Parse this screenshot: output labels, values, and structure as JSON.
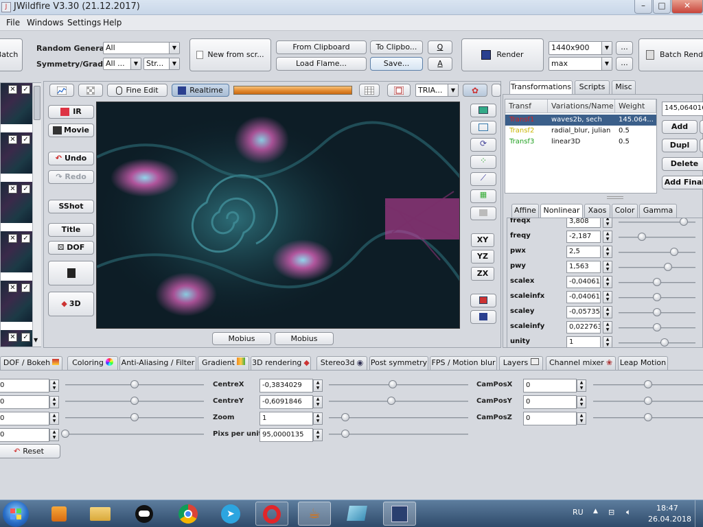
{
  "window": {
    "title": "JWildfire V3.30 (21.12.2017)",
    "minimize": "–",
    "maximize": "□",
    "close": "✕"
  },
  "menu": [
    "File",
    "Windows",
    "Settings",
    "Help"
  ],
  "toolbar": {
    "batch_left": "Batch",
    "random_generator_label": "Random Generator",
    "random_generator_value": "All",
    "symmetry_label": "Symmetry/Gradient",
    "symmetry_value": "All ...",
    "gradient_value": "Str...",
    "new_from_script": "New from scr...",
    "from_clipboard": "From Clipboard",
    "to_clipboard": "To Clipbo...",
    "q": "Q",
    "load_flame": "Load Flame...",
    "save": "Save...",
    "a": "A",
    "render": "Render",
    "resolution": "1440x900",
    "quality": "max",
    "more1": "...",
    "more2": "...",
    "batch_render": "Batch Render"
  },
  "preview_toolbar": {
    "fine_edit": "Fine Edit",
    "realtime": "Realtime",
    "triangle_mode": "TRIA..."
  },
  "left_buttons": {
    "ir": "IR",
    "movie": "Movie",
    "undo": "Undo",
    "redo": "Redo",
    "sshot": "SShot",
    "title": "Title",
    "dof": "DOF",
    "three_d": "3D"
  },
  "right_side_buttons": {
    "xy": "XY",
    "yz": "YZ",
    "zx": "ZX"
  },
  "mobius": [
    "Mobius",
    "Mobius"
  ],
  "right_tabs": [
    "Transformations",
    "Scripts",
    "Misc"
  ],
  "transforms_table": {
    "headers": [
      "Transf",
      "Variations/Name",
      "Weight"
    ],
    "rows": [
      {
        "name": "Transf1",
        "variations": "waves2b, sech",
        "weight": "145.064...",
        "color": "#d42020",
        "selected": true
      },
      {
        "name": "Transf2",
        "variations": "radial_blur, julian",
        "weight": "0.5",
        "color": "#c8b400",
        "selected": false
      },
      {
        "name": "Transf3",
        "variations": "linear3D",
        "weight": "0.5",
        "color": "#20a020",
        "selected": false
      }
    ]
  },
  "transform_side": {
    "weight_value": "145,064016",
    "add": "Add",
    "dupl": "Dupl",
    "delete": "Delete",
    "add_final": "Add Final"
  },
  "subtabs": [
    "Affine",
    "Nonlinear",
    "Xaos",
    "Color",
    "Gamma"
  ],
  "nonlinear_params": [
    {
      "label": "freqx",
      "value": "3,808",
      "level": 0.85
    },
    {
      "label": "freqy",
      "value": "-2,187",
      "level": 0.3
    },
    {
      "label": "pwx",
      "value": "2,5",
      "level": 0.72
    },
    {
      "label": "pwy",
      "value": "1,563",
      "level": 0.64
    },
    {
      "label": "scalex",
      "value": "-0,04061",
      "level": 0.5
    },
    {
      "label": "scaleinfx",
      "value": "-0,04061",
      "level": 0.5
    },
    {
      "label": "scaley",
      "value": "-0,05735",
      "level": 0.5
    },
    {
      "label": "scaleinfy",
      "value": "0,022763",
      "level": 0.5
    },
    {
      "label": "unity",
      "value": "1",
      "level": 0.6
    }
  ],
  "bottom_tabs": [
    "DOF / Bokeh",
    "Coloring",
    "Anti-Aliasing / Filter",
    "Gradient",
    "3D rendering",
    "Stereo3d",
    "Post symmetry",
    "FPS / Motion blur",
    "Layers",
    "Channel mixer",
    "Leap Motion"
  ],
  "camera": {
    "left_fields": [
      {
        "value": "0",
        "level": 0.5
      },
      {
        "value": "0",
        "level": 0.5
      },
      {
        "value": "0",
        "level": 0.5
      },
      {
        "value": "0",
        "level": 0.0
      }
    ],
    "reset": "Reset",
    "mid_fields": [
      {
        "label": "CentreX",
        "value": "-0,3834029",
        "level": 0.46
      },
      {
        "label": "CentreY",
        "value": "-0,6091846",
        "level": 0.45
      },
      {
        "label": "Zoom",
        "value": "1",
        "level": 0.12
      },
      {
        "label": "Pixs per unit",
        "value": "95,0000135",
        "level": 0.12
      }
    ],
    "right_fields": [
      {
        "label": "CamPosX",
        "value": "0",
        "level": 0.5
      },
      {
        "label": "CamPosY",
        "value": "0",
        "level": 0.5
      },
      {
        "label": "CamPosZ",
        "value": "0",
        "level": 0.5
      }
    ]
  },
  "taskbar": {
    "lang": "RU",
    "time": "18:47",
    "date": "26.04.2018"
  }
}
